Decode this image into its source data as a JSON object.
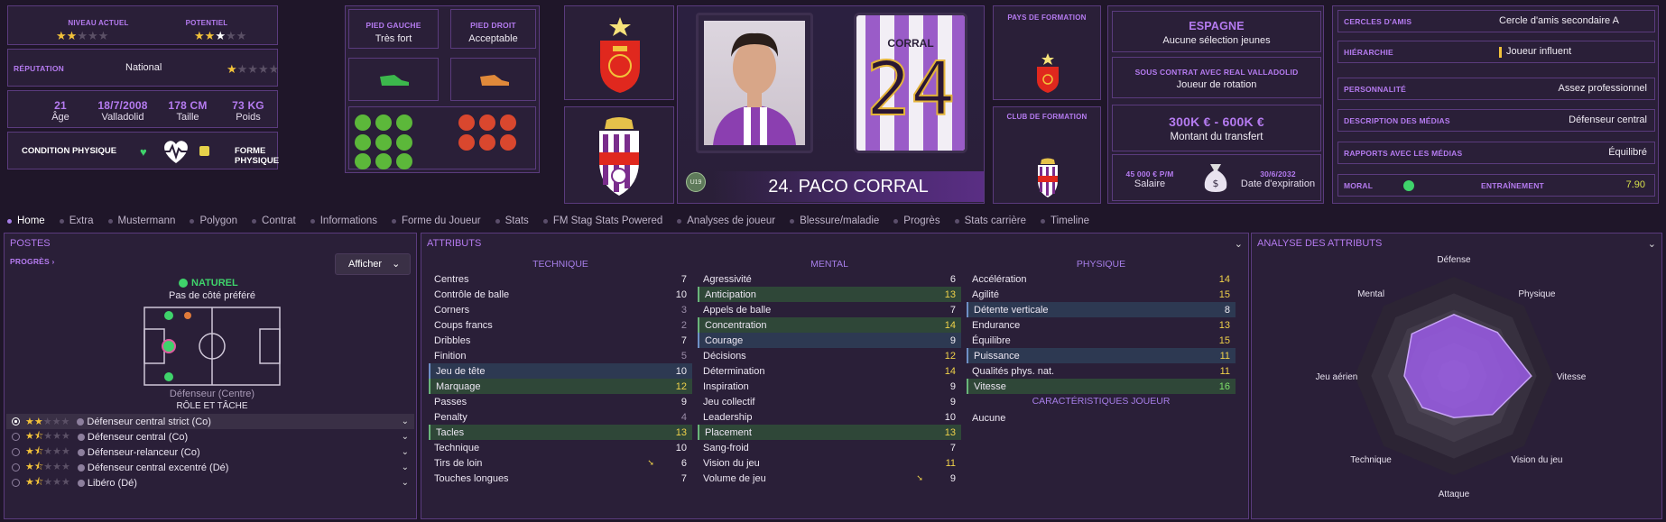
{
  "top": {
    "niveau_actuel_label": "NIVEAU ACTUEL",
    "niveau_actuel_stars": "★★★★★",
    "potentiel_label": "POTENTIEL",
    "reputation_label": "RÉPUTATION",
    "reputation_value": "National",
    "age": "21",
    "age_label": "Âge",
    "dob": "18/7/2008",
    "birthplace": "Valladolid",
    "height": "178 CM",
    "height_label": "Taille",
    "weight": "73 KG",
    "weight_label": "Poids",
    "condition_label": "CONDITION PHYSIQUE",
    "form_label": "FORME PHYSIQUE",
    "left_foot_label": "PIED GAUCHE",
    "left_foot_value": "Très fort",
    "right_foot_label": "PIED DROIT",
    "right_foot_value": "Acceptable",
    "shirt_name": "CORRAL",
    "shirt_number": "24",
    "player_name": "24. PACO CORRAL",
    "u19_badge": "U19",
    "training_country_label": "PAYS DE FORMATION",
    "training_club_label": "CLUB DE FORMATION",
    "nation": "ESPAGNE",
    "nation_sub": "Aucune sélection jeunes",
    "contract_label": "SOUS CONTRAT AVEC REAL VALLADOLID",
    "contract_role": "Joueur de rotation",
    "transfer_value": "300K € - 600K €",
    "transfer_label": "Montant du transfert",
    "salary": "45 000 € P/M",
    "salary_label": "Salaire",
    "expiry": "30/6/2032",
    "expiry_label": "Date d'expiration",
    "friends_label": "CERCLES D'AMIS",
    "friends_value": "Cercle d'amis secondaire A",
    "hierarchy_label": "HIÉRARCHIE",
    "hierarchy_value": "Joueur influent",
    "personality_label": "PERSONNALITÉ",
    "personality_value": "Assez professionnel",
    "media_desc_label": "DESCRIPTION DES MÉDIAS",
    "media_desc_value": "Défenseur central",
    "media_rel_label": "RAPPORTS AVEC LES MÉDIAS",
    "media_rel_value": "Équilibré",
    "morale_label": "MORAL",
    "training_label": "ENTRAÎNEMENT",
    "training_value": "7.90"
  },
  "ratings": {
    "current_stars": 2,
    "potential_stars": 2.5,
    "reputation_stars": 1
  },
  "tabs": [
    "Home",
    "Extra",
    "Mustermann",
    "Polygon",
    "Contrat",
    "Informations",
    "Forme du Joueur",
    "Stats",
    "FM Stag Stats Powered",
    "Analyses de joueur",
    "Blessure/maladie",
    "Progrès",
    "Stats carrière",
    "Timeline"
  ],
  "postes": {
    "title": "POSTES",
    "progress": "PROGRÈS",
    "show_btn": "Afficher",
    "natural": "NATUREL",
    "side": "Pas de côté préféré",
    "position": "Défenseur (Centre)",
    "role_task": "RÔLE ET TÂCHE",
    "roles": [
      "Défenseur central strict (Co)",
      "Défenseur central (Co)",
      "Défenseur-relanceur (Co)",
      "Défenseur central excentré (Dé)",
      "Libéro (Dé)"
    ],
    "role_stars": [
      2,
      1.5,
      1.5,
      1.5,
      1.5
    ]
  },
  "attributes": {
    "title": "ATTRIBUTS",
    "technique_title": "TECHNIQUE",
    "mental_title": "MENTAL",
    "physique_title": "PHYSIQUE",
    "technique": [
      [
        "Centres",
        "7"
      ],
      [
        "Contrôle de balle",
        "10"
      ],
      [
        "Corners",
        "3"
      ],
      [
        "Coups francs",
        "2"
      ],
      [
        "Dribbles",
        "7"
      ],
      [
        "Finition",
        "5"
      ],
      [
        "Jeu de tête",
        "10"
      ],
      [
        "Marquage",
        "12"
      ],
      [
        "Passes",
        "9"
      ],
      [
        "Penalty",
        "4"
      ],
      [
        "Tacles",
        "13"
      ],
      [
        "Technique",
        "10"
      ],
      [
        "Tirs de loin",
        "6"
      ],
      [
        "Touches longues",
        "7"
      ]
    ],
    "mental": [
      [
        "Agressivité",
        "6"
      ],
      [
        "Anticipation",
        "13"
      ],
      [
        "Appels de balle",
        "7"
      ],
      [
        "Concentration",
        "14"
      ],
      [
        "Courage",
        "9"
      ],
      [
        "Décisions",
        "12"
      ],
      [
        "Détermination",
        "14"
      ],
      [
        "Inspiration",
        "9"
      ],
      [
        "Jeu collectif",
        "9"
      ],
      [
        "Leadership",
        "10"
      ],
      [
        "Placement",
        "13"
      ],
      [
        "Sang-froid",
        "7"
      ],
      [
        "Vision du jeu",
        "11"
      ],
      [
        "Volume de jeu",
        "9"
      ]
    ],
    "physique": [
      [
        "Accélération",
        "14"
      ],
      [
        "Agilité",
        "15"
      ],
      [
        "Détente verticale",
        "8"
      ],
      [
        "Endurance",
        "13"
      ],
      [
        "Équilibre",
        "15"
      ],
      [
        "Puissance",
        "11"
      ],
      [
        "Qualités phys. nat.",
        "11"
      ],
      [
        "Vitesse",
        "16"
      ]
    ],
    "traits_title": "CARACTÉRISTIQUES JOUEUR",
    "traits_value": "Aucune"
  },
  "analysis": {
    "title": "ANALYSE DES ATTRIBUTS",
    "axes": [
      "Défense",
      "Physique",
      "Vitesse",
      "Vision du jeu",
      "Attaque",
      "Technique",
      "Jeu aérien",
      "Mental"
    ],
    "values": [
      0.62,
      0.62,
      0.78,
      0.55,
      0.42,
      0.45,
      0.5,
      0.6
    ]
  }
}
